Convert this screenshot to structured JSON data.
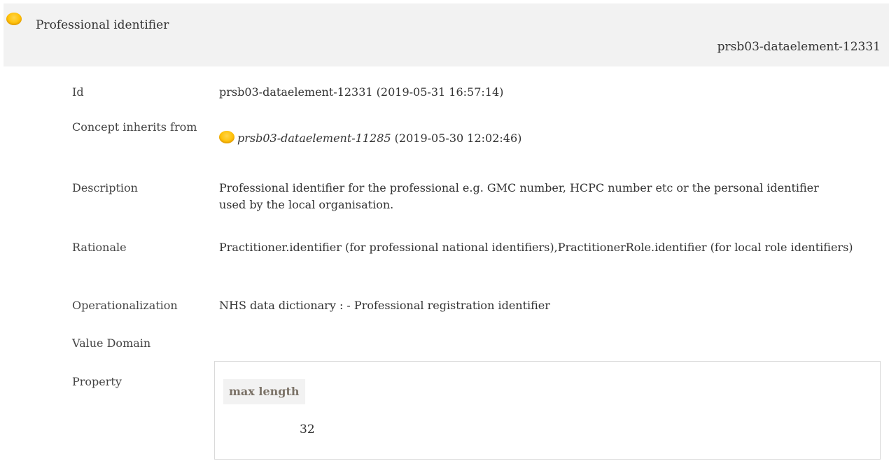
{
  "header": {
    "title": "Professional identifier",
    "id": "prsb03-dataelement-12331"
  },
  "fields": {
    "id": {
      "label": "Id",
      "value": "prsb03-dataelement-12331 (2019-05-31 16:57:14)"
    },
    "inherits": {
      "label": "Concept inherits from",
      "ref_id": "prsb03-dataelement-11285",
      "ref_date": " (2019-05-30 12:02:46)"
    },
    "description": {
      "label": "Description",
      "value": "Professional identifier for the professional e.g. GMC number, HCPC number etc or the personal identifier used by the local organisation."
    },
    "rationale": {
      "label": "Rationale",
      "value": "Practitioner.identifier (for professional national identifiers),PractitionerRole.identifier (for local role identifiers)"
    },
    "operationalization": {
      "label": "Operationalization",
      "value": "NHS data dictionary : - Professional registration identifier"
    },
    "value_domain": {
      "label": "Value Domain"
    },
    "property": {
      "label": "Property",
      "header": "max length",
      "value": "32"
    }
  },
  "colors": {
    "status_dot": "#ffc107",
    "header_bg": "#f2f2f2",
    "property_header_text": "#7b7267"
  },
  "icons": {
    "status": "status-dot-icon"
  }
}
